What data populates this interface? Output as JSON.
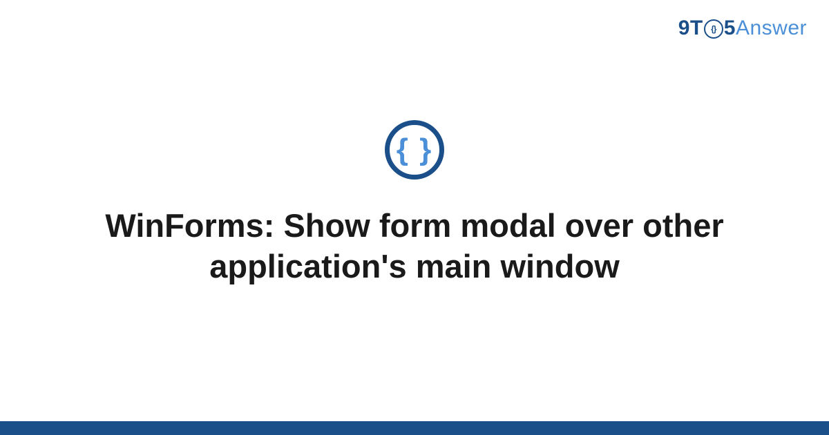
{
  "header": {
    "logo": {
      "pre": "9T",
      "clock_inner": "{}",
      "post": "5",
      "answer": "Answer"
    }
  },
  "main": {
    "icon_braces": "{ }",
    "title": "WinForms: Show form modal over other application's main window"
  },
  "colors": {
    "brand_dark": "#1a4f8a",
    "brand_light": "#4a8fd8",
    "text_heading": "#1a1a1a",
    "background": "#ffffff"
  }
}
